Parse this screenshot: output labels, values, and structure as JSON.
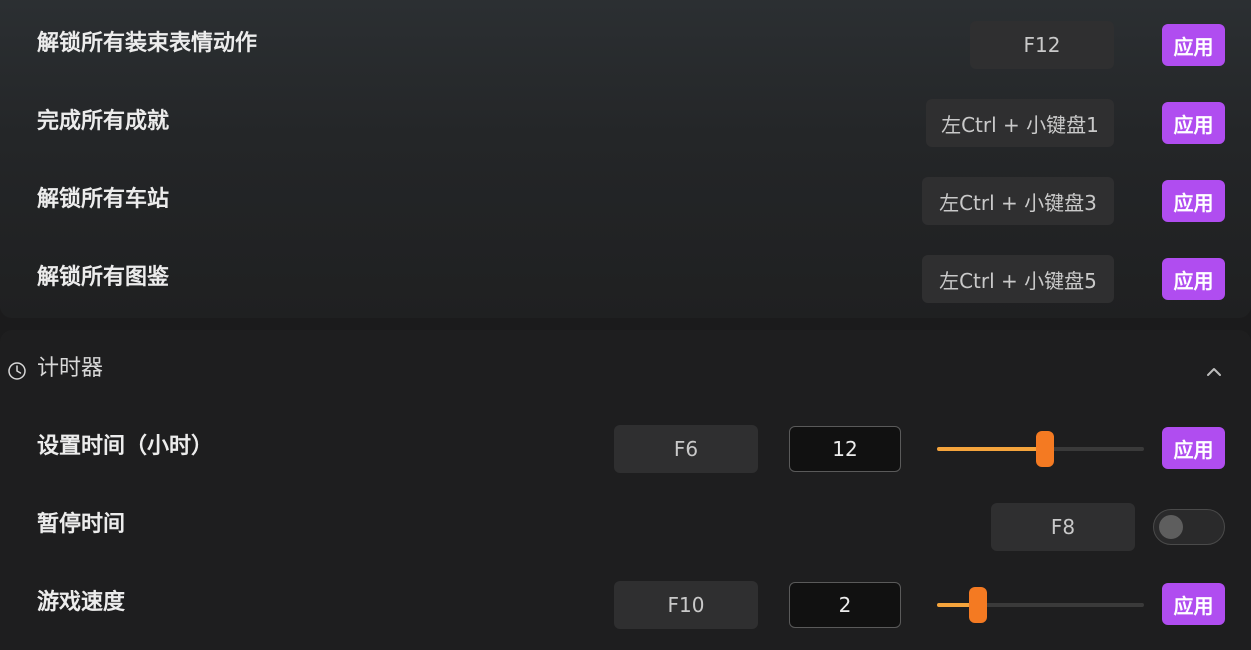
{
  "top_section": {
    "rows": [
      {
        "label": "解锁所有装束表情动作",
        "hotkey": "F12",
        "apply": "应用"
      },
      {
        "label": "完成所有成就",
        "hotkey": "左Ctrl + 小键盘1",
        "apply": "应用"
      },
      {
        "label": "解锁所有车站",
        "hotkey": "左Ctrl + 小键盘3",
        "apply": "应用"
      },
      {
        "label": "解锁所有图鉴",
        "hotkey": "左Ctrl + 小键盘5",
        "apply": "应用"
      }
    ]
  },
  "timer_section": {
    "title": "计时器",
    "icon": "clock-icon",
    "collapse_icon": "chevron-up-icon",
    "set_time": {
      "label": "设置时间（小时）",
      "hotkey": "F6",
      "value": "12",
      "slider_fraction": 0.52,
      "apply": "应用"
    },
    "pause_time": {
      "label": "暂停时间",
      "hotkey": "F8",
      "toggle_on": false
    },
    "game_speed": {
      "label": "游戏速度",
      "hotkey": "F10",
      "value": "2",
      "slider_fraction": 0.2,
      "apply": "应用"
    }
  },
  "colors": {
    "accent_purple": "#b04df0",
    "slider_fill": "#f5a43c",
    "slider_thumb": "#f47a22"
  }
}
